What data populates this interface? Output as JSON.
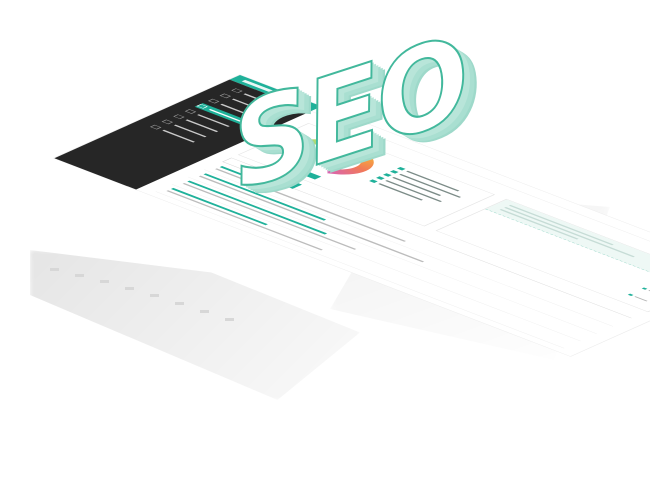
{
  "hero": {
    "word": "SEO"
  },
  "score": {
    "value": "",
    "level": 0.82
  },
  "colors": {
    "accent": "#1fb19a",
    "sidebar": "#262626",
    "alert": "#e7343f",
    "word_outline": "#42b89c"
  },
  "sidebar": {
    "items": [
      {
        "name": "nav-item-1",
        "active": false
      },
      {
        "name": "nav-item-2",
        "active": false
      },
      {
        "name": "nav-item-3",
        "active": false
      },
      {
        "name": "nav-item-4",
        "active": true
      },
      {
        "name": "nav-item-5",
        "active": false
      },
      {
        "name": "nav-item-6",
        "active": false
      },
      {
        "name": "nav-item-7",
        "active": false
      },
      {
        "name": "nav-item-8",
        "active": false
      }
    ]
  },
  "icons": [
    "avatar-icon",
    "checkbox-icon",
    "status-dot-icon",
    "gauge-icon"
  ]
}
